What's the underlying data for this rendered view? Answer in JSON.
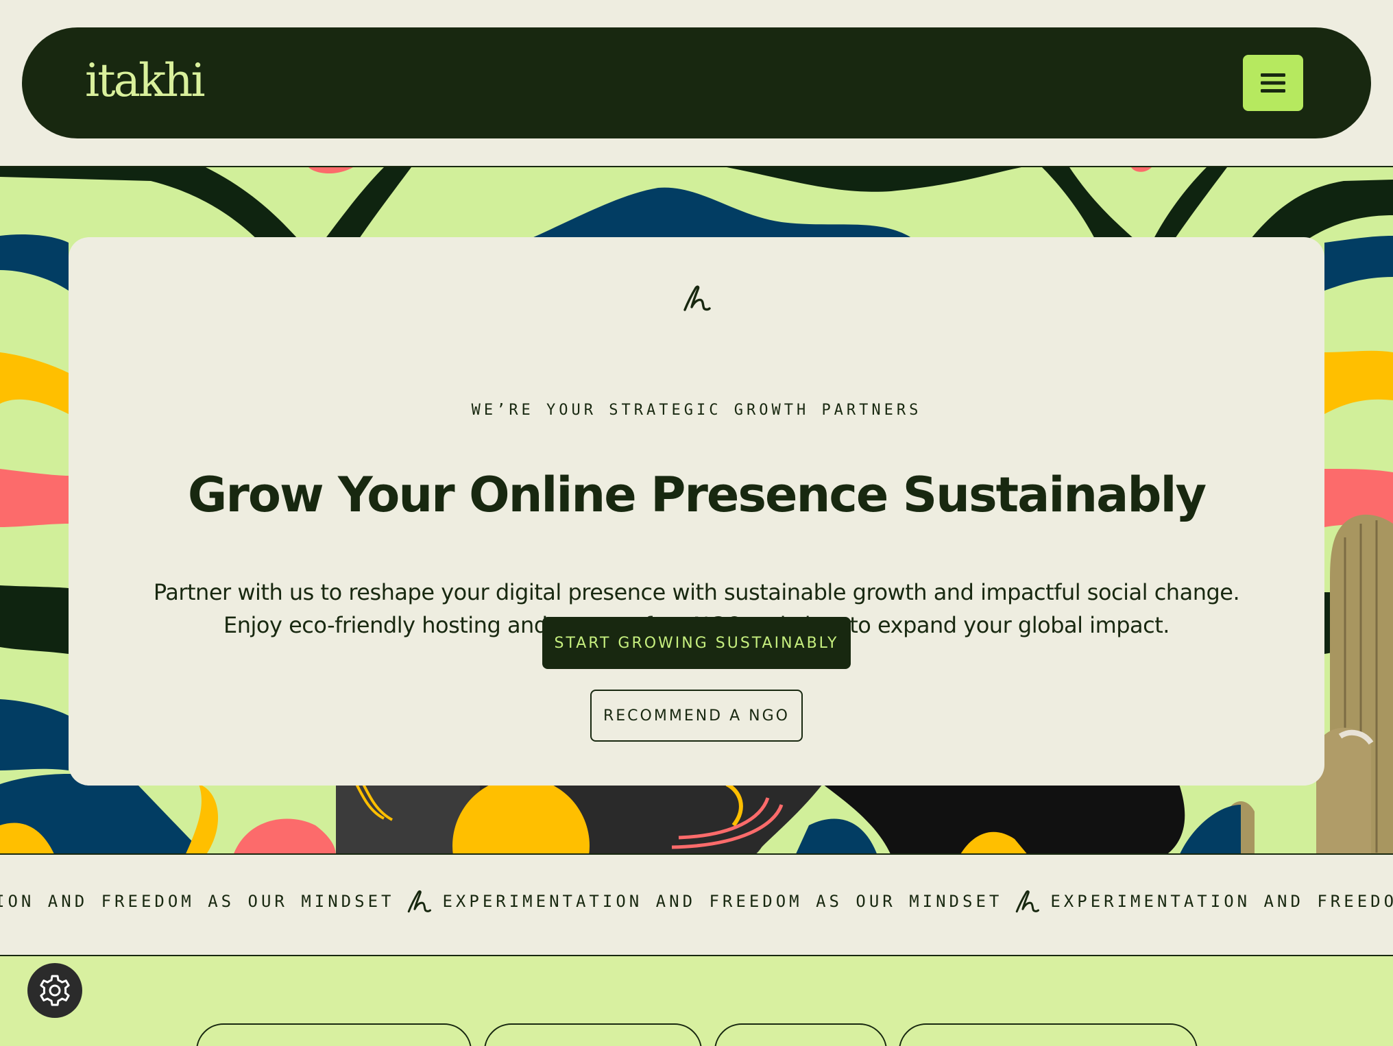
{
  "nav": {
    "logo": "itakhi",
    "menu_icon": "hamburger-icon"
  },
  "hero": {
    "eyebrow": "WE’RE YOUR STRATEGIC GROWTH PARTNERS",
    "headline": "Grow Your Online Presence Sustainably",
    "subtext_line1": "Partner with us to reshape your digital presence with sustainable growth and impactful social change.",
    "subtext_line2": "Enjoy eco-friendly hosting and sponsor-free NGO websites to expand your global impact.",
    "primary_cta": "START GROWING SUSTAINABLY",
    "secondary_cta": "RECOMMEND A NGO"
  },
  "marquee": {
    "items": [
      "ION AND FREEDOM AS OUR MINDSET",
      "EXPERIMENTATION AND FREEDOM AS OUR MINDSET",
      "EXPERIMENTATION AND FREEDOM AS OUR MINDSE"
    ]
  },
  "colors": {
    "dark": "#182810",
    "lime": "#b6e95f",
    "cream": "#eeede0",
    "pale_green": "#d1ef9a",
    "navy": "#023d63",
    "yellow": "#ffbf00",
    "coral": "#fc6b6b"
  },
  "icons": {
    "settings": "gear-icon",
    "brand_mark": "squiggle-icon"
  }
}
